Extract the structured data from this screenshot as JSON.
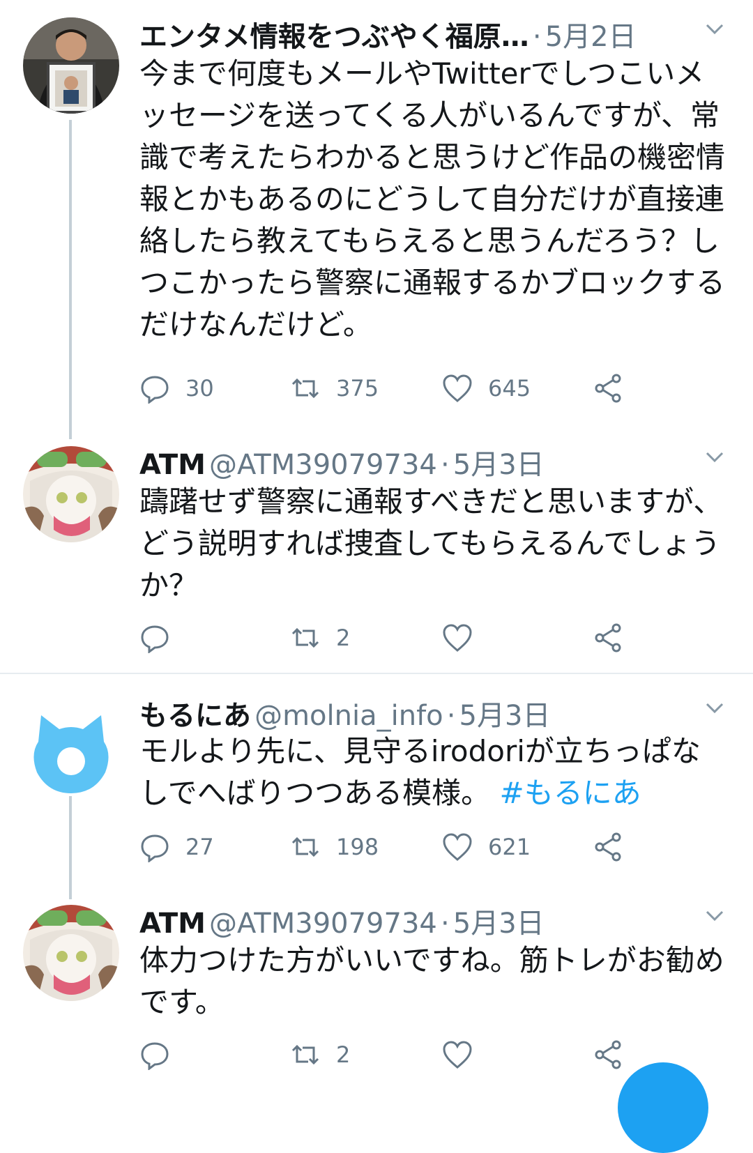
{
  "tweets": [
    {
      "name": "エンタメ情報をつぶやく福原…",
      "handle": "",
      "dot": "·",
      "date": "5月2日",
      "text": "今まで何度もメールやTwitterでしつこいメッセージを送ってくる人がいるんですが、常識で考えたらわかると思うけど作品の機密情報とかもあるのにどうして自分だけが直接連絡したら教えてもらえると思うんだろう？しつこかったら警察に通報するかブロックするだけなんだけど。",
      "hashtag": "",
      "replies": "30",
      "retweets": "375",
      "likes": "645"
    },
    {
      "name": "ATM",
      "handle": "@ATM39079734",
      "dot": "·",
      "date": "5月3日",
      "text": "躊躇せず警察に通報すべきだと思いますが、どう説明すれば捜査してもらえるんでしょうか？",
      "hashtag": "",
      "replies": "",
      "retweets": "2",
      "likes": ""
    },
    {
      "name": "もるにあ",
      "handle": "@molnia_info",
      "dot": "·",
      "date": "5月3日",
      "text": "モルより先に、見守るirodoriが立ちっぱなしでへばりつつある模様。",
      "hashtag": "#もるにあ",
      "replies": "27",
      "retweets": "198",
      "likes": "621"
    },
    {
      "name": "ATM",
      "handle": "@ATM39079734",
      "dot": "·",
      "date": "5月3日",
      "text": "体力つけた方がいいですね。筋トレがお勧めです。",
      "hashtag": "",
      "replies": "",
      "retweets": "2",
      "likes": ""
    }
  ],
  "icons": {
    "reply": "reply-icon",
    "retweet": "retweet-icon",
    "like": "heart-icon",
    "share": "share-icon",
    "more": "chevron-down-icon"
  },
  "colors": {
    "accent": "#1da1f2",
    "secondary_text": "#657786",
    "thread_line": "#c4cfd6",
    "divider": "#e6ecf0"
  }
}
